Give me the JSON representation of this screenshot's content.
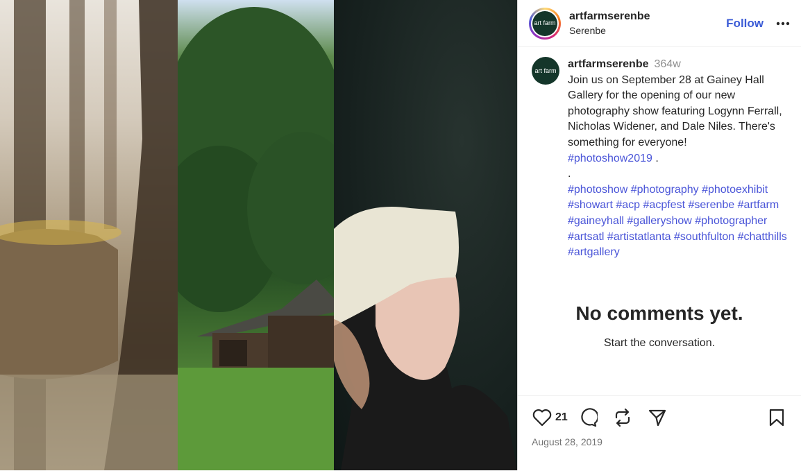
{
  "post": {
    "username": "artfarmserenbe",
    "location": "Serenbe",
    "follow_label": "Follow",
    "more_label": "•••",
    "avatar_text": "art farm",
    "caption": {
      "username": "artfarmserenbe",
      "time": "364w",
      "text": "Join us on September 28 at Gainey Hall Gallery for the opening of our new photography show featuring Logynn Ferrall, Nicholas Widener, and Dale Niles. There's something for everyone!",
      "first_tag": "#photoshow2019",
      "after_first": " .",
      "dot": ".",
      "tags": [
        "#photoshow",
        "#photography",
        "#photoexhibit",
        "#showart",
        "#acp",
        "#acpfest",
        "#serenbe",
        "#artfarm",
        "#gaineyhall",
        "#galleryshow",
        "#photographer",
        "#artsatl",
        "#artistatlanta",
        "#southfulton",
        "#chatthills",
        "#artgallery"
      ]
    },
    "comments": {
      "empty_title": "No comments yet.",
      "empty_sub": "Start the conversation."
    },
    "likes": "21",
    "date": "August 28, 2019"
  },
  "icons": [
    "heart-icon",
    "comment-icon",
    "repost-icon",
    "share-icon",
    "bookmark-icon"
  ]
}
